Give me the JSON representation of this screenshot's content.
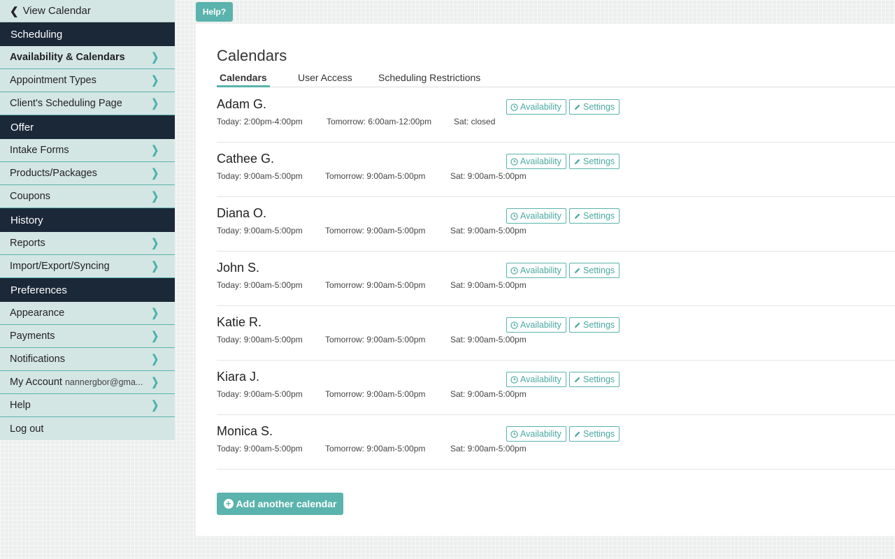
{
  "sidebar": {
    "back_label": "View Calendar",
    "sections": [
      {
        "title": "Scheduling",
        "items": [
          {
            "label": "Availability & Calendars",
            "active": true
          },
          {
            "label": "Appointment Types"
          },
          {
            "label": "Client's Scheduling Page"
          }
        ]
      },
      {
        "title": "Offer",
        "items": [
          {
            "label": "Intake Forms"
          },
          {
            "label": "Products/Packages"
          },
          {
            "label": "Coupons"
          }
        ]
      },
      {
        "title": "History",
        "items": [
          {
            "label": "Reports"
          },
          {
            "label": "Import/Export/Syncing"
          }
        ]
      },
      {
        "title": "Preferences",
        "items": [
          {
            "label": "Appearance"
          },
          {
            "label": "Payments"
          },
          {
            "label": "Notifications"
          },
          {
            "label": "My Account",
            "email": "nannergbor@gma..."
          },
          {
            "label": "Help"
          },
          {
            "label": "Log out"
          }
        ]
      }
    ]
  },
  "help_button": "Help?",
  "main": {
    "title": "Calendars",
    "tabs": [
      {
        "label": "Calendars",
        "active": true
      },
      {
        "label": "User Access"
      },
      {
        "label": "Scheduling Restrictions"
      }
    ],
    "calendars": [
      {
        "name": "Adam G.",
        "today": "Today: 2:00pm-4:00pm",
        "tomorrow": "Tomorrow: 6:00am-12:00pm",
        "sat": "Sat: closed"
      },
      {
        "name": "Cathee G.",
        "today": "Today: 9:00am-5:00pm",
        "tomorrow": "Tomorrow: 9:00am-5:00pm",
        "sat": "Sat: 9:00am-5:00pm"
      },
      {
        "name": "Diana O.",
        "today": "Today: 9:00am-5:00pm",
        "tomorrow": "Tomorrow: 9:00am-5:00pm",
        "sat": "Sat: 9:00am-5:00pm"
      },
      {
        "name": "John S.",
        "today": "Today: 9:00am-5:00pm",
        "tomorrow": "Tomorrow: 9:00am-5:00pm",
        "sat": "Sat: 9:00am-5:00pm"
      },
      {
        "name": "Katie R.",
        "today": "Today: 9:00am-5:00pm",
        "tomorrow": "Tomorrow: 9:00am-5:00pm",
        "sat": "Sat: 9:00am-5:00pm"
      },
      {
        "name": "Kiara J.",
        "today": "Today: 9:00am-5:00pm",
        "tomorrow": "Tomorrow: 9:00am-5:00pm",
        "sat": "Sat: 9:00am-5:00pm"
      },
      {
        "name": "Monica S.",
        "today": "Today: 9:00am-5:00pm",
        "tomorrow": "Tomorrow: 9:00am-5:00pm",
        "sat": "Sat: 9:00am-5:00pm"
      }
    ],
    "availability_label": "Availability",
    "settings_label": "Settings",
    "add_label": "Add another calendar"
  },
  "icons": {
    "back": "chevron-left-icon",
    "item": "chevron-right-icon",
    "availability": "clock-icon",
    "settings": "pencil-icon",
    "add": "plus-circle-icon"
  },
  "colors": {
    "accent": "#5ab3ad",
    "sidebar_section_bg": "#1b2838",
    "sidebar_item_bg": "#d4e6e4"
  }
}
